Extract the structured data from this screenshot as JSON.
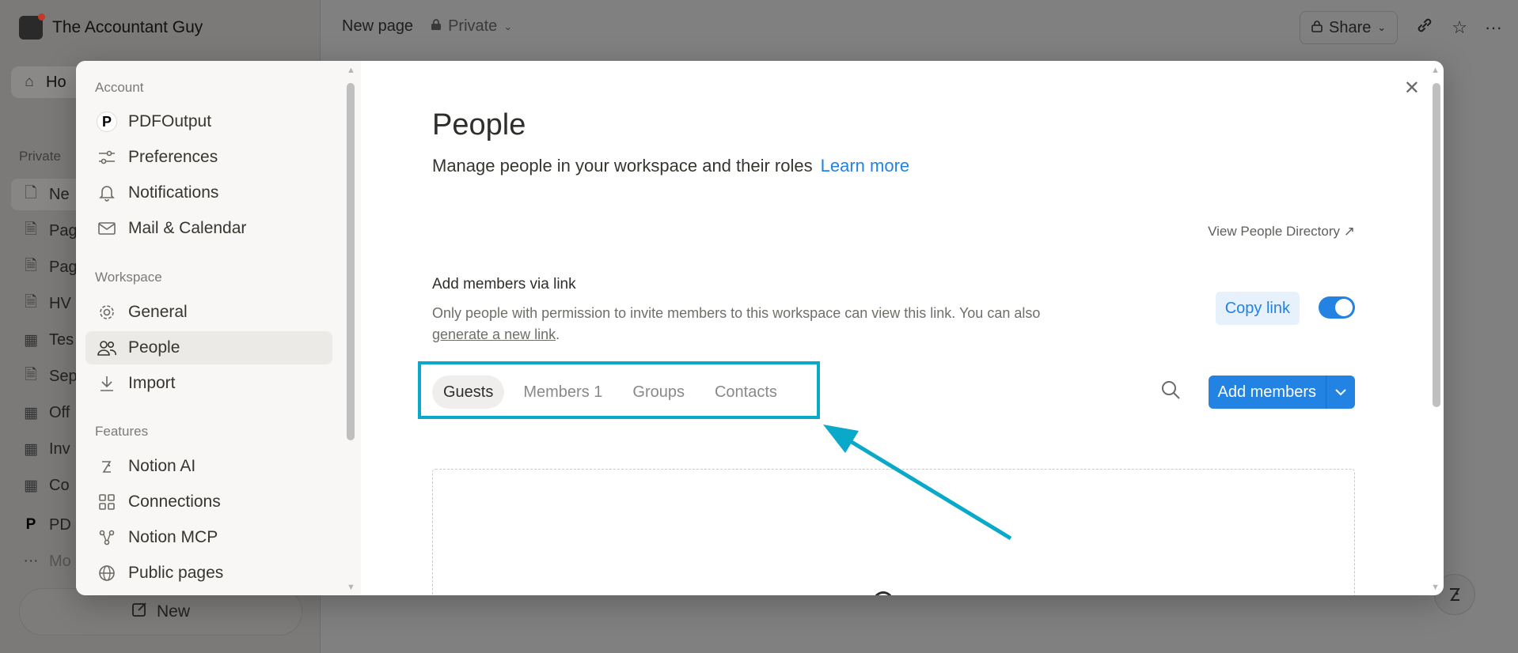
{
  "workspace": {
    "name": "The Accountant Guy"
  },
  "bg_sidebar": {
    "home_label": "Ho",
    "section_private": "Private",
    "items": [
      {
        "label": "Ne",
        "glyph": "🗋"
      },
      {
        "label": "Pag",
        "glyph": "🗎"
      },
      {
        "label": "Pag",
        "glyph": "🗎"
      },
      {
        "label": "HV",
        "glyph": "🗎"
      },
      {
        "label": "Tes",
        "glyph": "▦"
      },
      {
        "label": "Sep",
        "glyph": "🗎"
      },
      {
        "label": "Off",
        "glyph": "▦"
      },
      {
        "label": "Inv",
        "glyph": "▦"
      },
      {
        "label": "Co",
        "glyph": "▦"
      },
      {
        "label": "PD",
        "glyph": "P"
      },
      {
        "label": "Mo",
        "glyph": "···"
      }
    ],
    "new_label": "New"
  },
  "topbar": {
    "page_title": "New page",
    "privacy": "Private",
    "share_label": "Share"
  },
  "settings": {
    "account_section": "Account",
    "workspace_section": "Workspace",
    "features_section": "Features",
    "account_items": [
      "PDFOutput",
      "Preferences",
      "Notifications",
      "Mail & Calendar"
    ],
    "workspace_items": [
      "General",
      "People",
      "Import"
    ],
    "features_items": [
      "Notion AI",
      "Connections",
      "Notion MCP",
      "Public pages"
    ]
  },
  "people": {
    "title": "People",
    "subtitle": "Manage people in your workspace and their roles",
    "learn_more": "Learn more",
    "view_directory": "View People Directory ↗",
    "add_link_title": "Add members via link",
    "add_link_desc": "Only people with permission to invite members to this workspace can view this link. You can also",
    "generate_link": "generate a new link",
    "copy_link": "Copy link",
    "link_enabled": true,
    "tabs": [
      "Guests",
      "Members 1",
      "Groups",
      "Contacts"
    ],
    "active_tab": "Guests",
    "add_members": "Add members"
  },
  "colors": {
    "accent": "#2383e2",
    "highlight": "#0aa9c9"
  }
}
